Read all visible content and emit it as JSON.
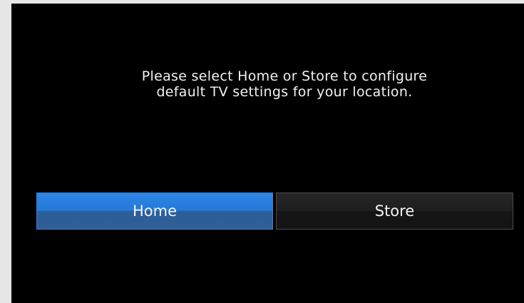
{
  "prompt": {
    "line1": "Please select Home or Store to configure",
    "line2": "default TV settings for your location."
  },
  "options": {
    "home_label": "Home",
    "store_label": "Store",
    "selected": "Home"
  },
  "colors": {
    "background": "#000000",
    "selected_button": "#2478d6",
    "unselected_button": "#1e1e1e",
    "text": "#f2f2f2"
  }
}
